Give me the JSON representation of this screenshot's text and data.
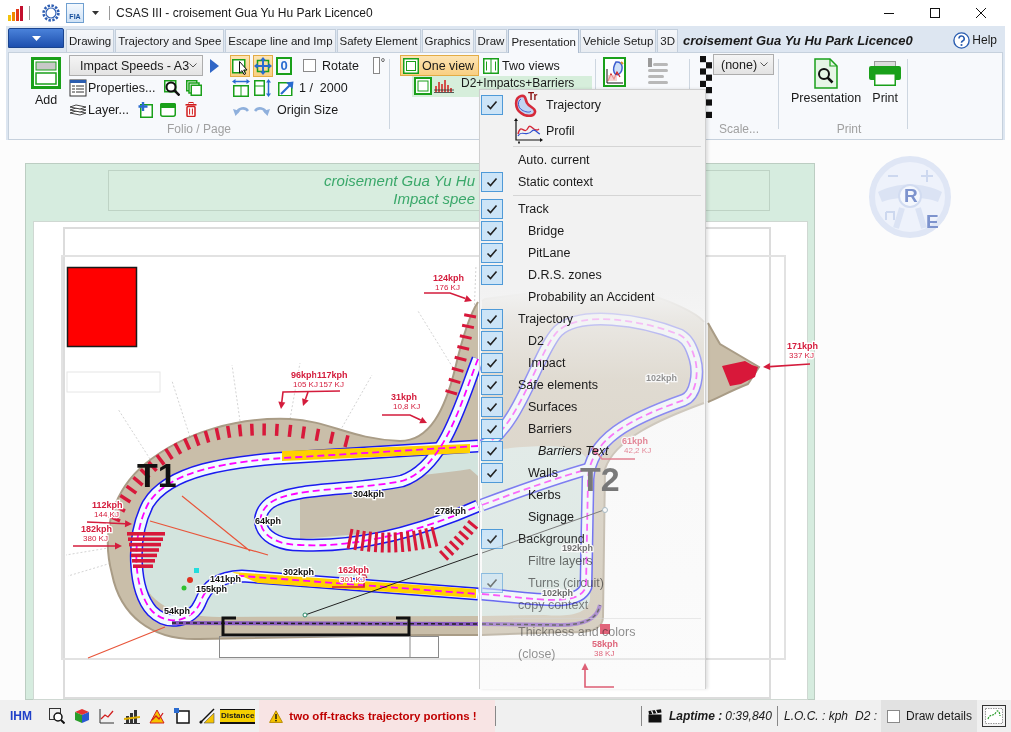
{
  "window": {
    "title": "CSAS III - croisement Gua Yu Hu Park Licence0",
    "quick_access_label": "FIA"
  },
  "tabs": [
    {
      "label": "Drawing",
      "selected": false
    },
    {
      "label": "Trajectory and Spee",
      "selected": false
    },
    {
      "label": "Escape line and Imp",
      "selected": false
    },
    {
      "label": "Safety Element",
      "selected": false
    },
    {
      "label": "Graphics",
      "selected": false
    },
    {
      "label": "Draw",
      "selected": false
    },
    {
      "label": "Presentation",
      "selected": true
    },
    {
      "label": "Vehicle Setup",
      "selected": false
    },
    {
      "label": "3D",
      "selected": false
    }
  ],
  "document_title": "croisement Gua Yu Hu Park Licence0",
  "help": "Help",
  "ribbon": {
    "folio_page": {
      "add": "Add",
      "page": "Impact Speeds - A3",
      "properties": "Properties...",
      "layer": "Layer...",
      "tools": [
        {
          "kind": "pointer",
          "selected": true
        },
        {
          "kind": "move",
          "selected": true
        },
        {
          "kind": "zero",
          "label": "0",
          "selected": false
        }
      ],
      "rotate": {
        "label": "Rotate",
        "checked": false
      },
      "degree_unit": "°",
      "scale": "1 /  2000",
      "history": [
        {
          "kind": "undo",
          "disabled": true
        },
        {
          "kind": "redo",
          "disabled": true
        }
      ],
      "origin_size": "Origin Size",
      "label": "Folio / Page"
    },
    "views": {
      "options": [
        {
          "label": "One view",
          "selected": true
        },
        {
          "label": "Two views",
          "selected": false
        }
      ],
      "layout": "D2+Impatcs+Barriers"
    },
    "scale": {
      "value": "(none)",
      "label": "Scale..."
    },
    "print": {
      "buttons": [
        {
          "kind": "preview",
          "label": "Presentation"
        },
        {
          "kind": "print",
          "label": "Print"
        }
      ],
      "label": "Print"
    }
  },
  "context_menu": {
    "sections": [
      {
        "kind": "icons",
        "items": [
          {
            "label": "Trajectory",
            "checked": true,
            "badge": "Tr"
          },
          {
            "label": "Profil",
            "checked": false
          }
        ]
      },
      {
        "kind": "plain",
        "items": [
          {
            "label": "Auto. current",
            "checked": false
          },
          {
            "label": "Static context",
            "checked": true
          }
        ]
      },
      {
        "kind": "plain",
        "items": [
          {
            "label": "Track",
            "checked": true,
            "children": [
              {
                "label": "Bridge",
                "checked": true
              },
              {
                "label": "PitLane",
                "checked": true
              },
              {
                "label": "D.R.S. zones",
                "checked": true
              },
              {
                "label": "Probability an Accident",
                "checked": false
              }
            ]
          },
          {
            "label": "Trajectory",
            "checked": true,
            "children": [
              {
                "label": "D2",
                "checked": true
              },
              {
                "label": "Impact",
                "checked": true
              }
            ]
          },
          {
            "label": "Safe elements",
            "checked": true,
            "children": [
              {
                "label": "Surfaces",
                "checked": true
              },
              {
                "label": "Barriers",
                "checked": true,
                "children": [
                  {
                    "label": "Barriers Text",
                    "checked": true
                  }
                ]
              },
              {
                "label": "Walls",
                "checked": true
              },
              {
                "label": "Kerbs",
                "checked": false
              },
              {
                "label": "Signage",
                "checked": false
              }
            ]
          },
          {
            "label": "Background",
            "checked": true,
            "children": [
              {
                "label": "Filtre layers",
                "checked": false
              },
              {
                "label": "Turns (circuit)",
                "checked": true
              }
            ]
          },
          {
            "label": "copy context",
            "checked": false
          }
        ]
      },
      {
        "kind": "plain",
        "items": [
          {
            "label": "Thickness and colors",
            "checked": false
          },
          {
            "label": "(close)",
            "checked": false
          }
        ]
      }
    ]
  },
  "page": {
    "title": "croisement Gua Yu Hu",
    "subtitle": "Impact spee",
    "turns": [
      "T1",
      "T2"
    ],
    "impacts": [
      {
        "speed": "124kph",
        "energy": "176 KJ"
      },
      {
        "speed": "96kph",
        "energy": "105 KJ"
      },
      {
        "speed": "117kph",
        "energy": "157 KJ"
      },
      {
        "speed": "31kph",
        "energy": "10,8 KJ"
      },
      {
        "speed": "112kph",
        "energy": "144 KJ"
      },
      {
        "speed": "182kph",
        "energy": "380 KJ"
      },
      {
        "speed": "171kph",
        "energy": "337 KJ"
      },
      {
        "speed": "61kph",
        "energy": "42,2 KJ"
      },
      {
        "speed": "58kph",
        "energy": "38 KJ"
      },
      {
        "speed": "162kph",
        "energy": "301 KJ"
      }
    ],
    "speeds": [
      "304kph",
      "64kph",
      "278kph",
      "302kph",
      "141kph",
      "155kph",
      "54kph",
      "192kph",
      "102kph",
      "102kph"
    ]
  },
  "logo": {
    "letters": [
      "R",
      "E"
    ]
  },
  "status_bar": {
    "mode": "IHM",
    "distance_tool": "Distance",
    "warning": "two off-tracks trajectory portions !",
    "laptime_label": "Laptime :",
    "laptime": "0:39,840",
    "loc": "L.O.C. : kph",
    "d2": "D2 :",
    "draw_details": {
      "label": "Draw details",
      "checked": false
    }
  }
}
